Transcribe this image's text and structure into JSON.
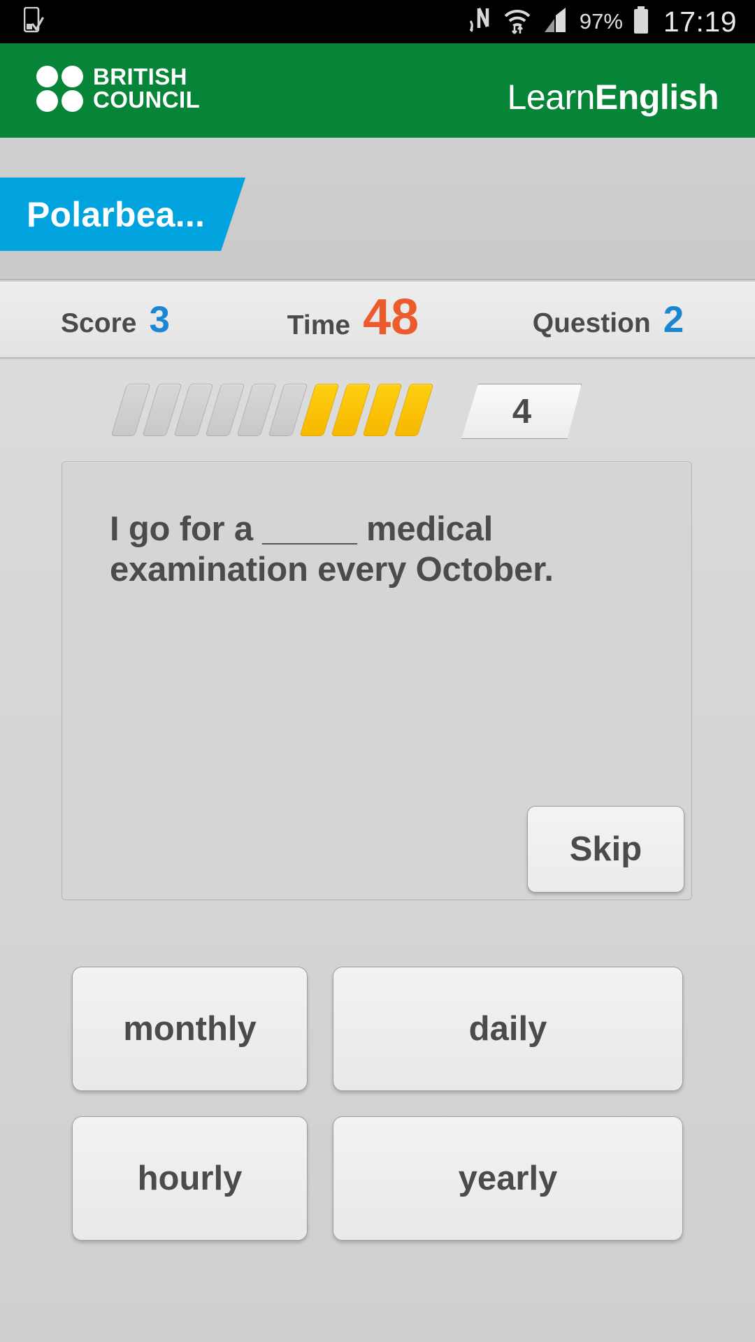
{
  "statusbar": {
    "icons": [
      "sim-card-check-icon",
      "nfc-icon",
      "wifi-icon",
      "signal-icon",
      "battery-icon"
    ],
    "battery_percent": "97%",
    "time": "17:19"
  },
  "header": {
    "brand_line1": "BRITISH",
    "brand_line2": "COUNCIL",
    "product_thin": "Learn",
    "product_bold": "English",
    "background_color": "#068437"
  },
  "tab": {
    "label": "Polarbea...",
    "color": "#00a3dd"
  },
  "stats": {
    "score_label": "Score",
    "score_value": "3",
    "time_label": "Time",
    "time_value": "48",
    "question_label": "Question",
    "question_value": "2",
    "value_color": "#1b87d2",
    "time_color": "#eb5b2b"
  },
  "progress": {
    "total_segments": 10,
    "filled_segments": 4,
    "filled_color": "#f6b800",
    "empty_color": "#c8c8c8",
    "counter": "4"
  },
  "question": {
    "text": "I go for a _____ medical examination every October.",
    "skip_label": "Skip"
  },
  "answers": [
    {
      "label": "monthly"
    },
    {
      "label": "daily"
    },
    {
      "label": "hourly"
    },
    {
      "label": "yearly"
    }
  ]
}
